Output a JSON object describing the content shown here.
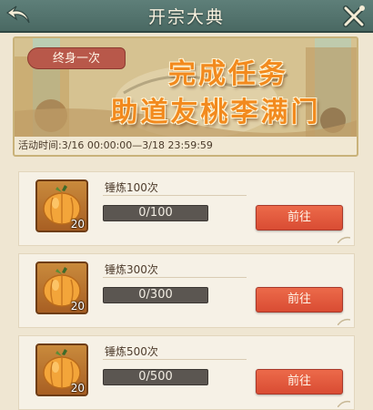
{
  "header": {
    "title": "开宗大典",
    "back_icon": "back-arrow-icon",
    "close_icon": "close-icon"
  },
  "banner": {
    "ribbon": "终身一次",
    "headline_line1": "完成任务",
    "headline_line2": "助道友桃李满门",
    "time_text": "活动时间:3/16 00:00:00—3/18 23:59:59"
  },
  "colors": {
    "header_bg": "#4f6f69",
    "headline": "#f28a1e",
    "button": "#e25a3d",
    "progress_bg": "#5b5651",
    "page_bg": "#efe6d2"
  },
  "tasks": [
    {
      "name": "锤炼100次",
      "progress_text": "0/100",
      "progress": 0,
      "reward_count": "20",
      "button": "前往",
      "reward_icon": "gourd-fruit-icon"
    },
    {
      "name": "锤炼300次",
      "progress_text": "0/300",
      "progress": 0,
      "reward_count": "20",
      "button": "前往",
      "reward_icon": "gourd-fruit-icon"
    },
    {
      "name": "锤炼500次",
      "progress_text": "0/500",
      "progress": 0,
      "reward_count": "20",
      "button": "前往",
      "reward_icon": "gourd-fruit-icon"
    }
  ]
}
